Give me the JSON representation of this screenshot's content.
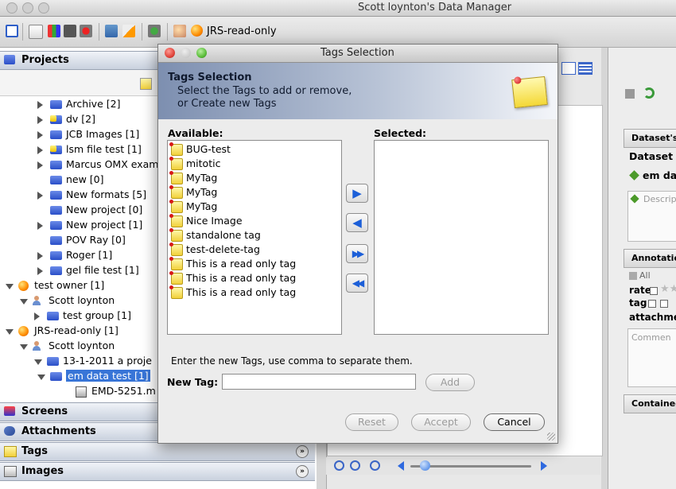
{
  "window": {
    "title": "Scott loynton's Data Manager"
  },
  "toolbar": {
    "group_label": "JRS-read-only"
  },
  "left_panel": {
    "projects_header": "Projects",
    "tree": [
      {
        "label": "Archive [2]",
        "level": 3,
        "expander": "right",
        "icon": "folder"
      },
      {
        "label": "dv [2]",
        "level": 3,
        "expander": "right",
        "icon": "folder-tag"
      },
      {
        "label": "JCB Images [1]",
        "level": 3,
        "expander": "right",
        "icon": "folder"
      },
      {
        "label": "lsm file test [1]",
        "level": 3,
        "expander": "right",
        "icon": "folder-tag"
      },
      {
        "label": "Marcus OMX examp",
        "level": 3,
        "expander": "right",
        "icon": "folder"
      },
      {
        "label": "new [0]",
        "level": 3,
        "expander": "none",
        "icon": "folder"
      },
      {
        "label": "New formats [5]",
        "level": 3,
        "expander": "right",
        "icon": "folder"
      },
      {
        "label": "New project [0]",
        "level": 3,
        "expander": "none",
        "icon": "folder"
      },
      {
        "label": "New project [1]",
        "level": 3,
        "expander": "right",
        "icon": "folder"
      },
      {
        "label": "POV Ray [0]",
        "level": 3,
        "expander": "none",
        "icon": "folder"
      },
      {
        "label": "Roger [1]",
        "level": 3,
        "expander": "right",
        "icon": "folder"
      },
      {
        "label": "gel file test [1]",
        "level": 3,
        "expander": "right",
        "icon": "dataset"
      },
      {
        "label": "test owner [1]",
        "level": 0,
        "expander": "down",
        "icon": "group"
      },
      {
        "label": "Scott loynton",
        "level": 1,
        "expander": "down",
        "icon": "person"
      },
      {
        "label": "test group [1]",
        "level": 2,
        "expander": "right",
        "icon": "folder"
      },
      {
        "label": "JRS-read-only [1]",
        "level": 0,
        "expander": "down",
        "icon": "group"
      },
      {
        "label": "Scott loynton",
        "level": 1,
        "expander": "down",
        "icon": "person"
      },
      {
        "label": "13-1-2011 a proje",
        "level": 2,
        "expander": "down",
        "icon": "folder"
      },
      {
        "label": "em data test [1]",
        "level": 3,
        "expander": "down",
        "icon": "dataset",
        "selected": true
      },
      {
        "label": "EMD-5251.m",
        "level": 4,
        "expander": "none",
        "icon": "image"
      }
    ],
    "sections": [
      "Screens",
      "Attachments",
      "Tags",
      "Images"
    ]
  },
  "right_panel": {
    "headers": [
      "Dataset's d",
      "Annotation",
      "Contained"
    ],
    "dataset_label": "Dataset I",
    "name_value": "em da",
    "description_placeholder": "Descrip",
    "all_label": "All",
    "rate_label": "rate",
    "tag_label": "tag",
    "attachments_label": "attachme",
    "comment_placeholder": "Commen"
  },
  "dialog": {
    "title": "Tags Selection",
    "banner_title": "Tags Selection",
    "banner_line1": "Select the Tags to add or remove,",
    "banner_line2": "or Create new Tags",
    "available_label": "Available:",
    "selected_label": "Selected:",
    "available": [
      "BUG-test",
      "mitotic",
      "MyTag",
      "MyTag",
      "MyTag",
      "Nice Image",
      "standalone tag",
      "test-delete-tag",
      "This is a read only tag",
      "This is a read only tag",
      "This is a read only tag"
    ],
    "selected": [],
    "hint": "Enter the new Tags, use comma to separate them.",
    "new_tag_label": "New Tag:",
    "new_tag_value": "",
    "add_button": "Add",
    "reset_button": "Reset",
    "accept_button": "Accept",
    "cancel_button": "Cancel"
  },
  "colors": {
    "selection": "#3875d7",
    "banner_start": "#7d8fb0",
    "arrow_blue": "#1c5fd8",
    "close_red": "#e0453c"
  }
}
